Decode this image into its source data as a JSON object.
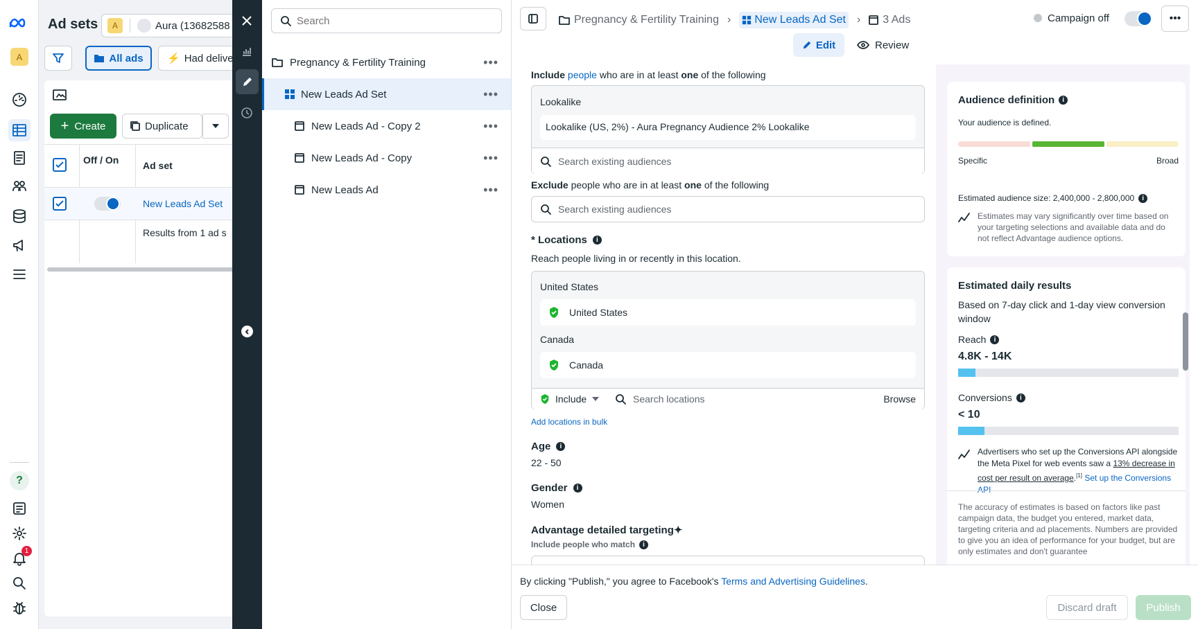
{
  "nav": {
    "account_letter": "A",
    "notification_count": "1"
  },
  "adsets_panel": {
    "title": "Ad sets",
    "account_badge": "A",
    "account_name": "Aura (13682588",
    "filter_all_ads": "All ads",
    "filter_had_delivery": "Had deliver",
    "create_label": "Create",
    "duplicate_label": "Duplicate",
    "col_offon": "Off / On",
    "col_adset": "Ad set",
    "row_name": "New Leads Ad Set",
    "results_text": "Results from 1 ad s"
  },
  "tree": {
    "search_placeholder": "Search",
    "items": [
      {
        "label": "Pregnancy & Fertility Training"
      },
      {
        "label": "New Leads Ad Set"
      },
      {
        "label": "New Leads Ad - Copy 2"
      },
      {
        "label": "New Leads Ad - Copy"
      },
      {
        "label": "New Leads Ad"
      }
    ]
  },
  "header": {
    "breadcrumb_campaign": "Pregnancy & Fertility Training",
    "breadcrumb_adset": "New Leads Ad Set",
    "breadcrumb_ads": "3 Ads",
    "campaign_status": "Campaign off",
    "edit_label": "Edit",
    "review_label": "Review"
  },
  "audience": {
    "include_prefix": "Include",
    "include_link": "people",
    "include_mid": "who are in at least",
    "include_bold": "one",
    "include_suffix": "of the following",
    "lookalike_heading": "Lookalike",
    "lookalike_value": "Lookalike (US, 2%) - Aura Pregnancy Audience 2% Lookalike",
    "search_existing": "Search existing audiences",
    "exclude_prefix": "Exclude",
    "exclude_mid": "people who are in at least",
    "exclude_bold": "one",
    "exclude_suffix": "of the following",
    "exclude_search": "Search existing audiences"
  },
  "locations": {
    "label": "* Locations",
    "subtitle": "Reach people living in or recently in this location.",
    "groups": [
      {
        "heading": "United States",
        "value": "United States"
      },
      {
        "heading": "Canada",
        "value": "Canada"
      }
    ],
    "include_select": "Include",
    "search_placeholder": "Search locations",
    "browse": "Browse",
    "add_bulk": "Add locations in bulk"
  },
  "age": {
    "label": "Age",
    "value": "22 - 50"
  },
  "gender": {
    "label": "Gender",
    "value": "Women"
  },
  "advantage": {
    "label": "Advantage detailed targeting",
    "sublabel": "Include people who match"
  },
  "sidebar": {
    "audience_def_title": "Audience definition",
    "audience_def_status": "Your audience is defined.",
    "specific": "Specific",
    "broad": "Broad",
    "estimated_size": "Estimated audience size: 2,400,000 - 2,800,000",
    "estimates_note": "Estimates may vary significantly over time based on your targeting selections and available data and do not reflect Advantage audience options.",
    "daily_title": "Estimated daily results",
    "daily_subtitle": "Based on 7-day click and 1-day view conversion window",
    "reach_label": "Reach",
    "reach_value": "4.8K - 14K",
    "reach_fill": 0.08,
    "conv_label": "Conversions",
    "conv_value": "< 10",
    "conv_fill": 0.12,
    "capi_text_1": "Advertisers who set up the Conversions API alongside the Meta Pixel for web events saw a",
    "capi_link_1": "13% decrease in cost per result on average",
    "capi_sup": "[1]",
    "capi_link_2": "Set up the Conversions API",
    "accuracy_note": "The accuracy of estimates is based on factors like past campaign data, the budget you entered, market data, targeting criteria and ad placements. Numbers are provided to give you an idea of performance for your budget, but are only estimates and don't guarantee"
  },
  "footer": {
    "agree_text": "By clicking \"Publish,\" you agree to Facebook's",
    "terms_link": "Terms and Advertising Guidelines",
    "close": "Close",
    "discard": "Discard draft",
    "publish": "Publish"
  },
  "colors": {
    "accent": "#0a66c2",
    "create_green": "#1d7a3f",
    "check_green": "#1db52f",
    "notification_red": "#e41e3f",
    "meter_green": "#59b534"
  }
}
